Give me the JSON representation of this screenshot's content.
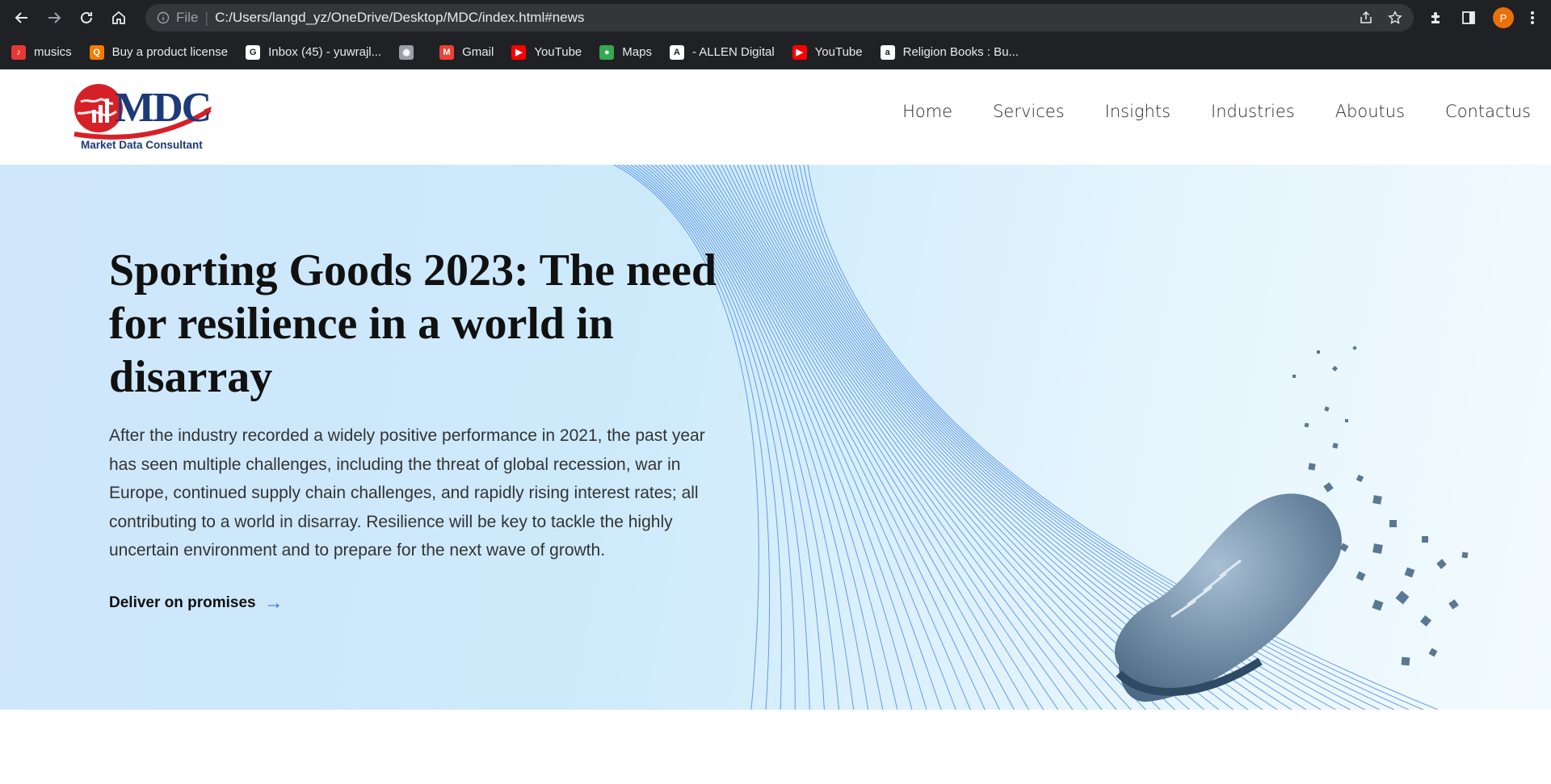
{
  "browser": {
    "file_label": "File",
    "url": "C:/Users/langd_yz/OneDrive/Desktop/MDC/index.html#news",
    "profile_initial": "P",
    "bookmarks": [
      {
        "label": "musics",
        "icon": "music-icon",
        "color": "#e53935"
      },
      {
        "label": "Buy a product license",
        "icon": "license-icon",
        "color": "#f57c00"
      },
      {
        "label": "Inbox (45) - yuwrajl...",
        "icon": "google-icon",
        "color": "#ffffff"
      },
      {
        "label": "",
        "icon": "globe-icon",
        "color": "#9aa0a6"
      },
      {
        "label": "Gmail",
        "icon": "gmail-icon",
        "color": "#ea4335"
      },
      {
        "label": "YouTube",
        "icon": "youtube-icon",
        "color": "#ff0000"
      },
      {
        "label": "Maps",
        "icon": "maps-icon",
        "color": "#34a853"
      },
      {
        "label": "- ALLEN Digital",
        "icon": "allen-icon",
        "color": "#ffffff"
      },
      {
        "label": "YouTube",
        "icon": "youtube-icon",
        "color": "#ff0000"
      },
      {
        "label": "Religion Books : Bu...",
        "icon": "amazon-icon",
        "color": "#ffffff"
      }
    ]
  },
  "site": {
    "logo_text": "MDC",
    "logo_subtitle": "Market Data Consultant",
    "nav": [
      "Home",
      "Services",
      "Insights",
      "Industries",
      "Aboutus",
      "Contactus"
    ]
  },
  "hero": {
    "title": "Sporting Goods 2023: The need for resilience in a world in disarray",
    "body": "After the industry recorded a widely positive performance in 2021, the past year has seen multiple challenges, including the threat of global recession, war in Europe, continued supply chain challenges, and rapidly rising interest rates; all contributing to a world in disarray. Resilience will be key to tackle the highly uncertain environment and to prepare for the next wave of growth.",
    "cta": "Deliver on promises"
  },
  "colors": {
    "accent": "#3b6fd8",
    "brand": "#1d3a7a",
    "logo_red": "#d62027"
  }
}
